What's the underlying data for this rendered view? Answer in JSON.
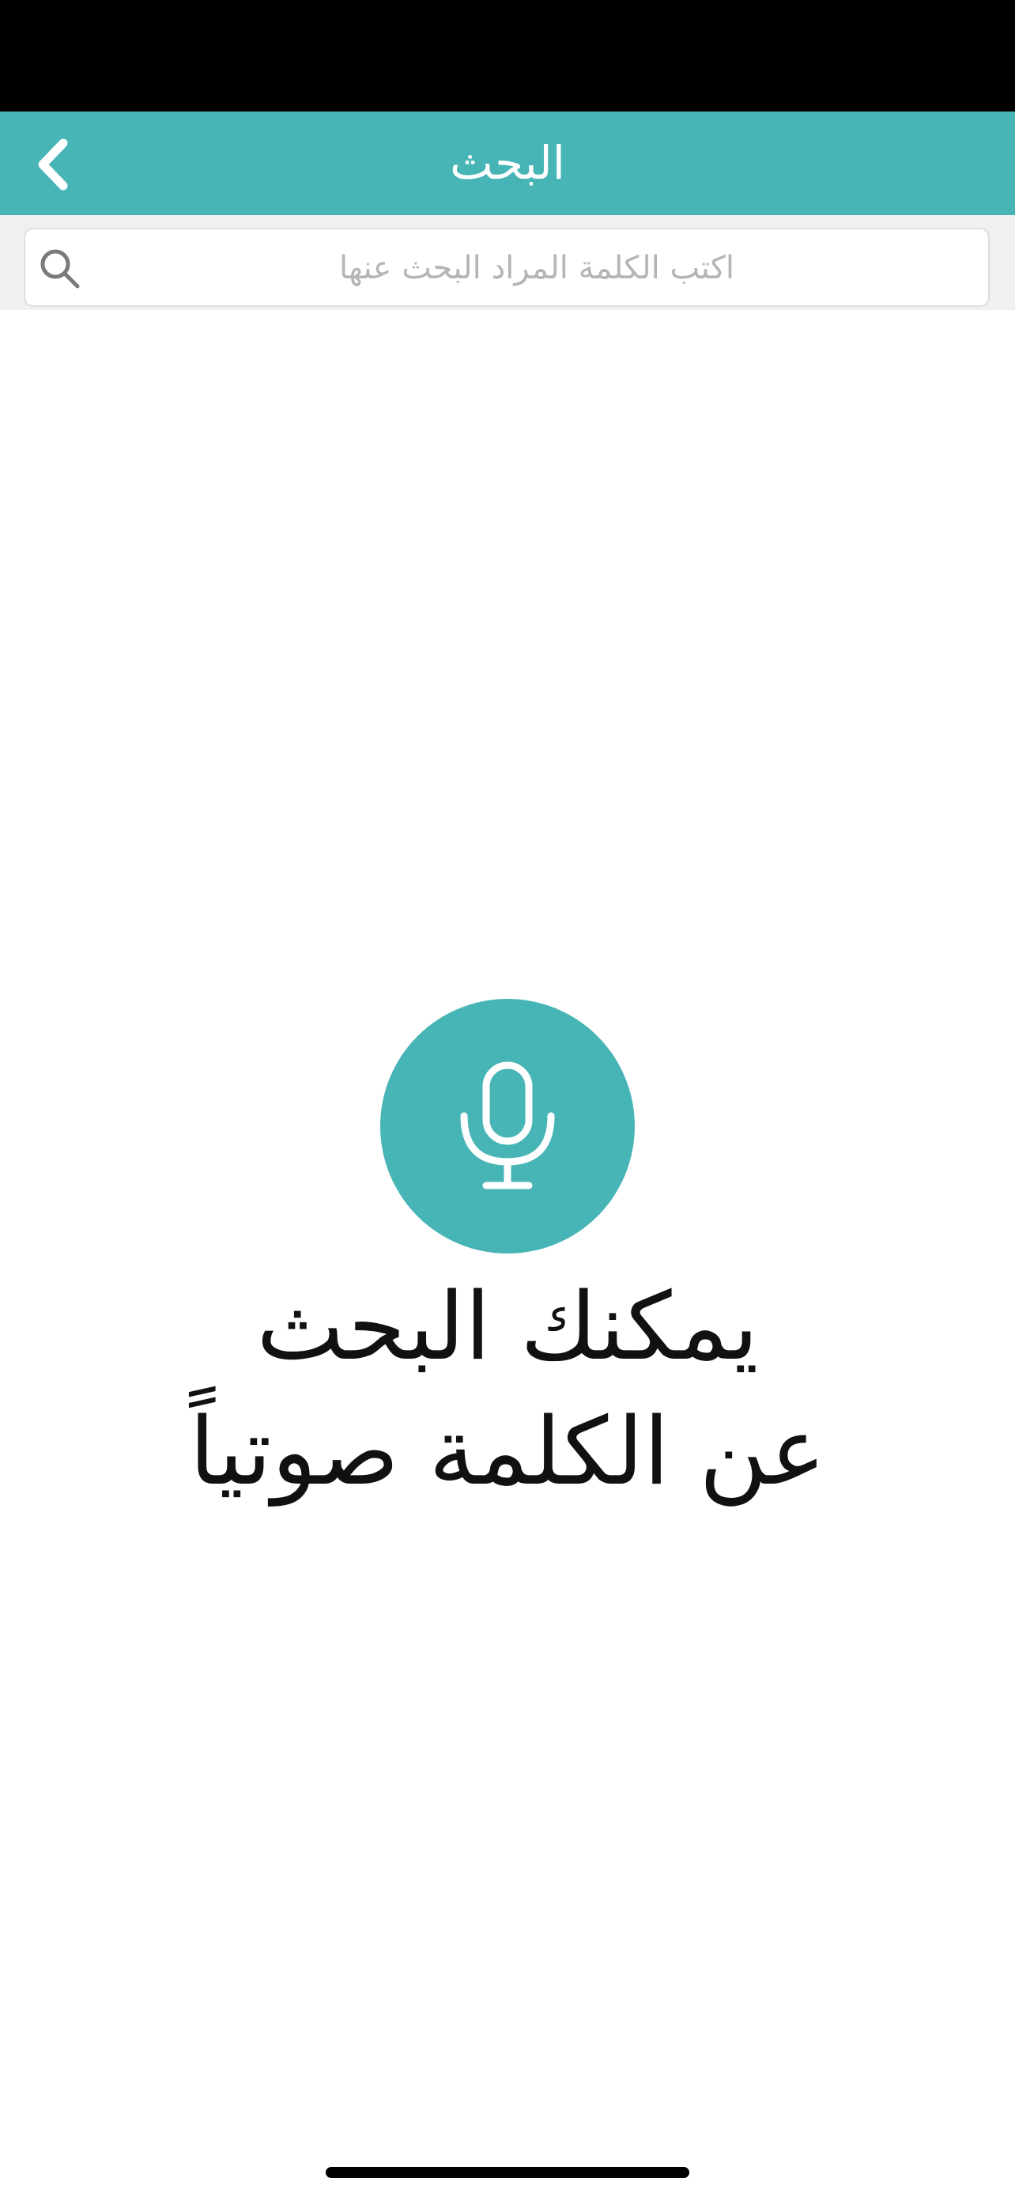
{
  "header": {
    "title": "البحث",
    "back_icon": "chevron-left-icon"
  },
  "search": {
    "placeholder": "اكتب الكلمة المراد البحث عنها",
    "value": "",
    "icon": "search-icon"
  },
  "voice": {
    "icon": "microphone-icon",
    "hint_line1": "يمكنك البحث",
    "hint_line2": "عن الكلمة صوتياً"
  },
  "colors": {
    "accent": "#47b5b6",
    "status_bar": "#000000",
    "search_area_bg": "#f0f0f0",
    "text": "#111111",
    "placeholder": "#b5b5b5"
  }
}
